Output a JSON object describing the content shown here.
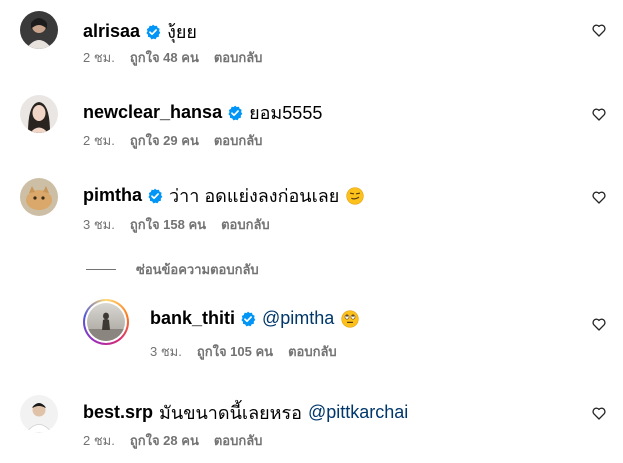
{
  "comments": [
    {
      "username": "alrisaa",
      "text": "งุ้ยย",
      "time": "2 ชม.",
      "likes": "ถูกใจ 48 คน",
      "reply": "ตอบกลับ"
    },
    {
      "username": "newclear_hansa",
      "text": "ยอม5555",
      "time": "2 ชม.",
      "likes": "ถูกใจ 29 คน",
      "reply": "ตอบกลับ"
    },
    {
      "username": "pimtha",
      "text": "ว่าา อดแย่งลงก่อนเลย",
      "time": "3 ชม.",
      "likes": "ถูกใจ 158 คน",
      "reply": "ตอบกลับ"
    },
    {
      "username": "bank_thiti",
      "mention": "@pimtha",
      "time": "3 ชม.",
      "likes": "ถูกใจ 105 คน",
      "reply": "ตอบกลับ"
    },
    {
      "username": "best.srp",
      "text": "มันขนาดนี้เลยหรอ",
      "mention": "@pittkarchai",
      "time": "2 ชม.",
      "likes": "ถูกใจ 28 คน",
      "reply": "ตอบกลับ"
    }
  ],
  "hide_replies_label": "ซ่อนข้อความตอบกลับ",
  "colors": {
    "verified": "#0095f6",
    "meta": "#737373",
    "mention": "#00376b"
  }
}
